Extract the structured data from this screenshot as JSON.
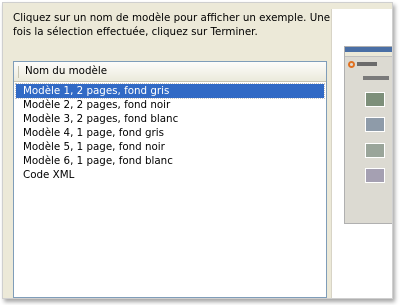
{
  "dialog": {
    "instructions": "Cliquez sur un nom de modèle pour afficher un exemple. Une fois la sélection effectuée, cliquez sur Terminer."
  },
  "list": {
    "column_header": "Nom du modèle",
    "items": [
      {
        "label": "Modèle 1, 2 pages, fond gris",
        "selected": true
      },
      {
        "label": "Modèle 2, 2 pages, fond noir",
        "selected": false
      },
      {
        "label": "Modèle 3, 2 pages, fond blanc",
        "selected": false
      },
      {
        "label": "Modèle 4, 1 page, fond gris",
        "selected": false
      },
      {
        "label": "Modèle 5, 1 page, fond noir",
        "selected": false
      },
      {
        "label": "Modèle 6, 1 page, fond blanc",
        "selected": false
      },
      {
        "label": "Code XML",
        "selected": false
      }
    ]
  },
  "colors": {
    "selection": "#316ac5",
    "dialog_bg": "#ece9d8"
  }
}
